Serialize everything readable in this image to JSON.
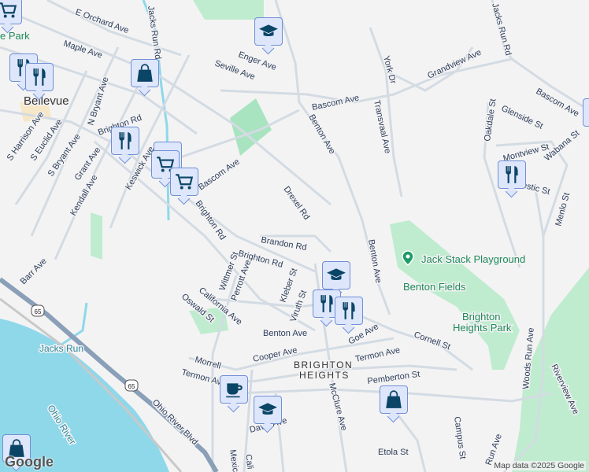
{
  "map": {
    "places": {
      "bellevue": "Bellevue",
      "brighton_heights_1": "BRIGHTON",
      "brighton_heights_2": "HEIGHTS"
    },
    "parks": {
      "park_partial": "e Park",
      "jack_stack": "Jack Stack Playground",
      "benton_fields": "Benton Fields",
      "bh_park_1": "Brighton",
      "bh_park_2": "Heights Park"
    },
    "water": {
      "jacks_run": "Jacks Run",
      "ohio_river": "Ohio River"
    },
    "route_shield": "65",
    "streets": {
      "e_orchard": "E Orchard Ave",
      "maple": "Maple Ave",
      "jacks_run_rd": "Jacks Run Rd",
      "n_bryant": "N Bryant Ave",
      "brighton_rd": "Brighton Rd",
      "s_harrison": "S Harrison Ave",
      "s_euclid": "S Euclid Ave",
      "s_bryant": "S Bryant Ave",
      "grant": "Grant Ave",
      "kendall": "Kendall Ave",
      "keswick": "Keswick Ave",
      "bascom": "Bascom Ave",
      "enger": "Enger Ave",
      "seville": "Seville Ave",
      "grandview": "Grandview Ave",
      "york": "York Dr",
      "transvaal": "Transvaal Ave",
      "benton": "Benton Ave",
      "oakdale": "Oakdale St",
      "glenside": "Glenside St",
      "montview": "Montview St",
      "wabana": "Wabana St",
      "domestic": "Domestic St",
      "menlo": "Menlo St",
      "drexel": "Drexel Rd",
      "brandon": "Brandon Rd",
      "wittmer": "Wittmer St",
      "perrott": "Perrott Ave",
      "kleber": "Kleber St",
      "viruth": "Viruth St",
      "california": "California Ave",
      "oswald": "Oswald St",
      "barr": "Barr Ave",
      "ohio_river_blvd": "Ohio River Blvd",
      "morrell": "Morrell",
      "cooper": "Cooper Ave",
      "termon": "Termon Ave",
      "goe": "Goe Ave",
      "cornell": "Cornell St",
      "pemberton": "Pemberton St",
      "mcclure": "McClure Ave",
      "campus": "Campus St",
      "etola": "Etola St",
      "woods_run": "Woods Run Ave",
      "run_ave": "Run Ave",
      "riverview": "Riverview Ave",
      "davis": "Davis Ave",
      "mexico": "Mexic",
      "california_partial": "Cali"
    },
    "attribution": "Map data ©2025 Google",
    "logo": "Google"
  },
  "markers": [
    {
      "type": "school-icon"
    },
    {
      "type": "shopping-bag-icon"
    },
    {
      "type": "restaurant-icon"
    },
    {
      "type": "restaurant-icon"
    },
    {
      "type": "shopping-cart-icon"
    },
    {
      "type": "shopping-cart-icon"
    },
    {
      "type": "school-icon"
    },
    {
      "type": "restaurant-icon"
    },
    {
      "type": "restaurant-icon"
    },
    {
      "type": "restaurant-icon"
    },
    {
      "type": "coffee-icon"
    },
    {
      "type": "school-icon"
    },
    {
      "type": "shopping-bag-icon"
    },
    {
      "type": "shopping-bag-icon"
    },
    {
      "type": "shopping-cart-icon"
    }
  ],
  "colors": {
    "land": "#f4f3f4",
    "road": "#d3dbe3",
    "highway": "#8a9fb8",
    "water": "#8ed8ea",
    "park": "#bfeccf",
    "icon": "#0b4566",
    "marker_bg": "#dde6fb"
  }
}
